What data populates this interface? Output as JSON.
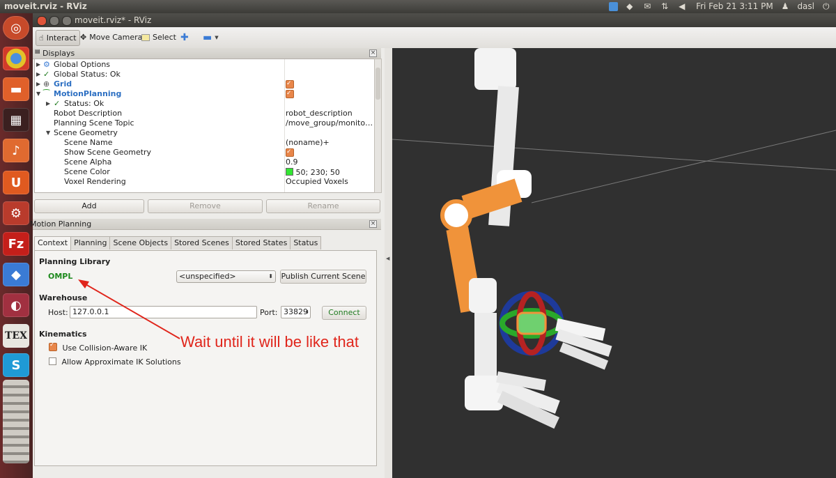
{
  "top_panel": {
    "title": "moveit.rviz - RViz",
    "datetime": "Fri Feb 21  3:11 PM",
    "user": "dasl",
    "icons": [
      "chat-icon",
      "dropbox-icon",
      "mail-icon",
      "network-icon",
      "volume-icon",
      "power-icon"
    ]
  },
  "launcher": {
    "apps": [
      "ubuntu-icon",
      "chrome-icon",
      "files-icon",
      "workspaces-icon",
      "media-icon",
      "ubuntu-one-icon",
      "settings-icon",
      "filezilla-icon",
      "dropbox-icon",
      "gnome-icon",
      "tex-icon",
      "skype-icon",
      "stack-icon"
    ]
  },
  "window": {
    "title": "moveit.rviz* - RViz"
  },
  "toolbar": {
    "interact": "Interact",
    "move_camera": "Move Camera",
    "select": "Select"
  },
  "displays": {
    "title": "Displays",
    "rows": [
      {
        "name": "Global Options",
        "value": ""
      },
      {
        "name": "Global Status: Ok",
        "value": ""
      },
      {
        "name": "Grid",
        "value": ""
      },
      {
        "name": "MotionPlanning",
        "value": ""
      },
      {
        "name": "Status: Ok",
        "value": ""
      },
      {
        "name": "Robot Description",
        "value": "robot_description"
      },
      {
        "name": "Planning Scene Topic",
        "value": "/move_group/monito…"
      },
      {
        "name": "Scene Geometry",
        "value": ""
      },
      {
        "name": "Scene Name",
        "value": "(noname)+"
      },
      {
        "name": "Show Scene Geometry",
        "value": ""
      },
      {
        "name": "Scene Alpha",
        "value": "0.9"
      },
      {
        "name": "Scene Color",
        "value": "50; 230; 50"
      },
      {
        "name": "Voxel Rendering",
        "value": "Occupied Voxels"
      }
    ],
    "scene_color": "#32e632",
    "buttons": {
      "add": "Add",
      "remove": "Remove",
      "rename": "Rename"
    }
  },
  "motion_planning": {
    "title": "Motion Planning",
    "tabs": [
      "Context",
      "Planning",
      "Scene Objects",
      "Stored Scenes",
      "Stored States",
      "Status"
    ],
    "planning_library_label": "Planning Library",
    "library": "OMPL",
    "planner_select": "<unspecified>",
    "publish_button": "Publish Current Scene",
    "warehouse_label": "Warehouse",
    "host_label": "Host:",
    "host_value": "127.0.0.1",
    "port_label": "Port:",
    "port_value": "33829",
    "connect_button": "Connect",
    "kinematics_label": "Kinematics",
    "collision_aware": "Use Collision-Aware IK",
    "approx_ik": "Allow Approximate IK Solutions"
  },
  "annotation": {
    "text": "Wait until it will be like that",
    "color": "#e0251b"
  }
}
